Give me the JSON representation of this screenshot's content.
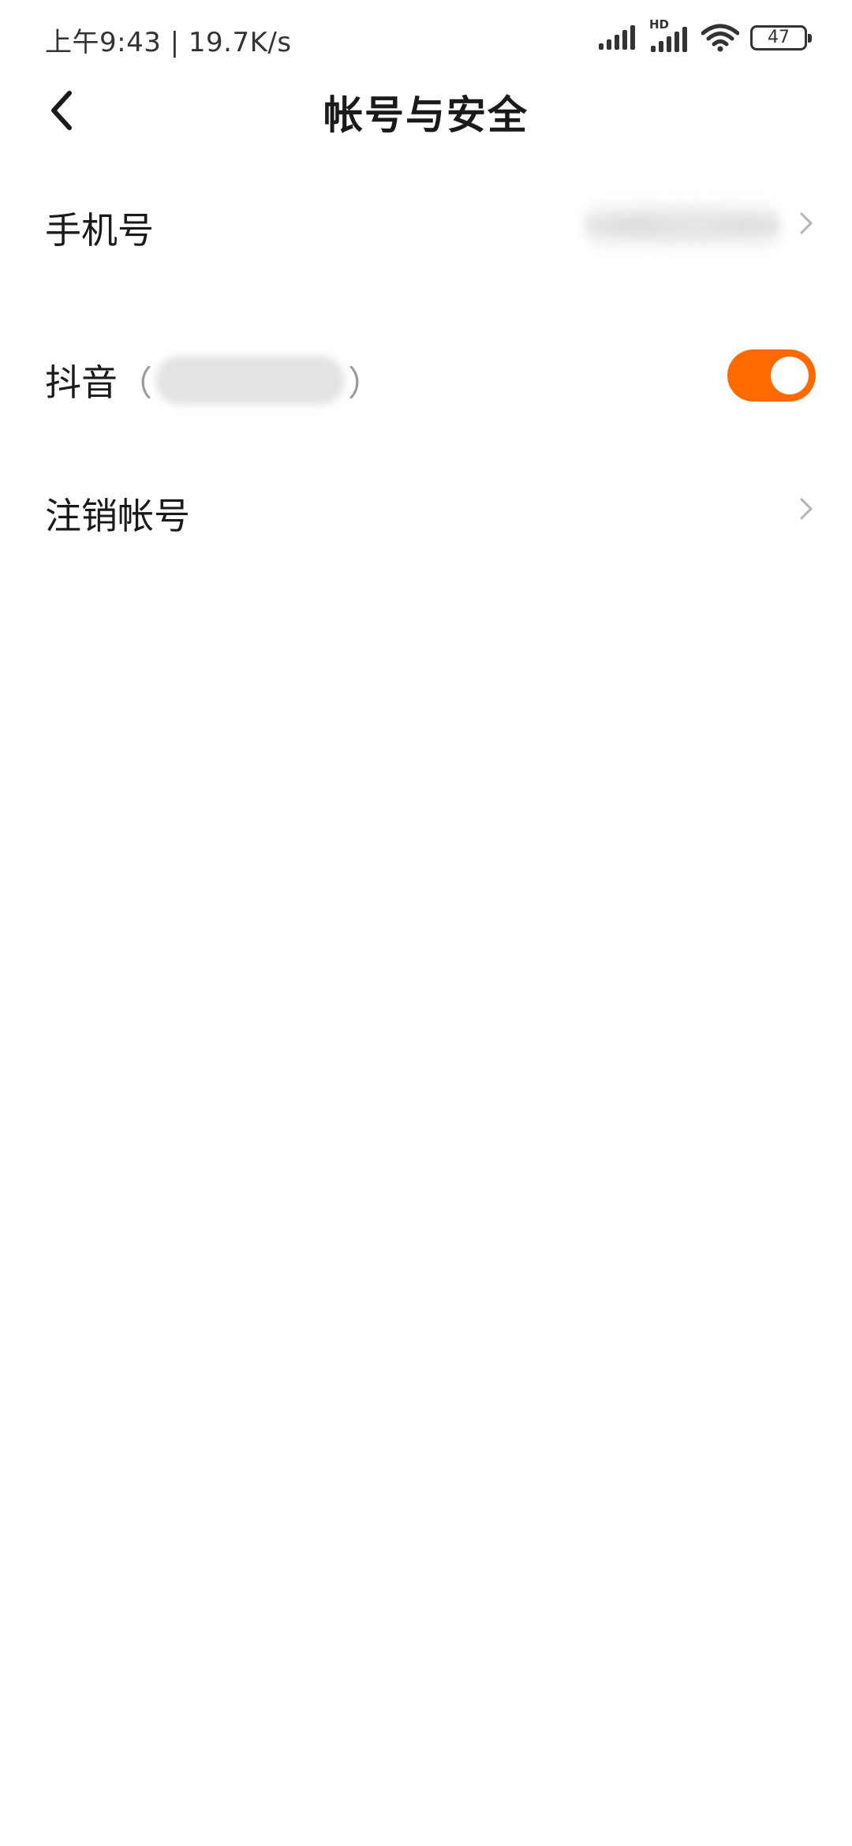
{
  "status_bar": {
    "time": "上午9:43 | 19.7K/s",
    "battery": "47",
    "hd_label": "HD",
    "icons": [
      "signal-icon",
      "hd-signal-icon",
      "wifi-icon",
      "battery-icon"
    ]
  },
  "header": {
    "title": "帐号与安全",
    "back_icon": "back-chevron-icon"
  },
  "rows": {
    "phone": {
      "label": "手机号",
      "value_redacted": true
    },
    "douyin": {
      "label": "抖音",
      "paren_open": "（",
      "paren_close": "）",
      "toggle_on": true
    },
    "cancel_account": {
      "label": "注销帐号"
    }
  },
  "colors": {
    "accent": "#ff6a00",
    "text": "#1a1a1a",
    "chevron": "#b3b3b3"
  }
}
